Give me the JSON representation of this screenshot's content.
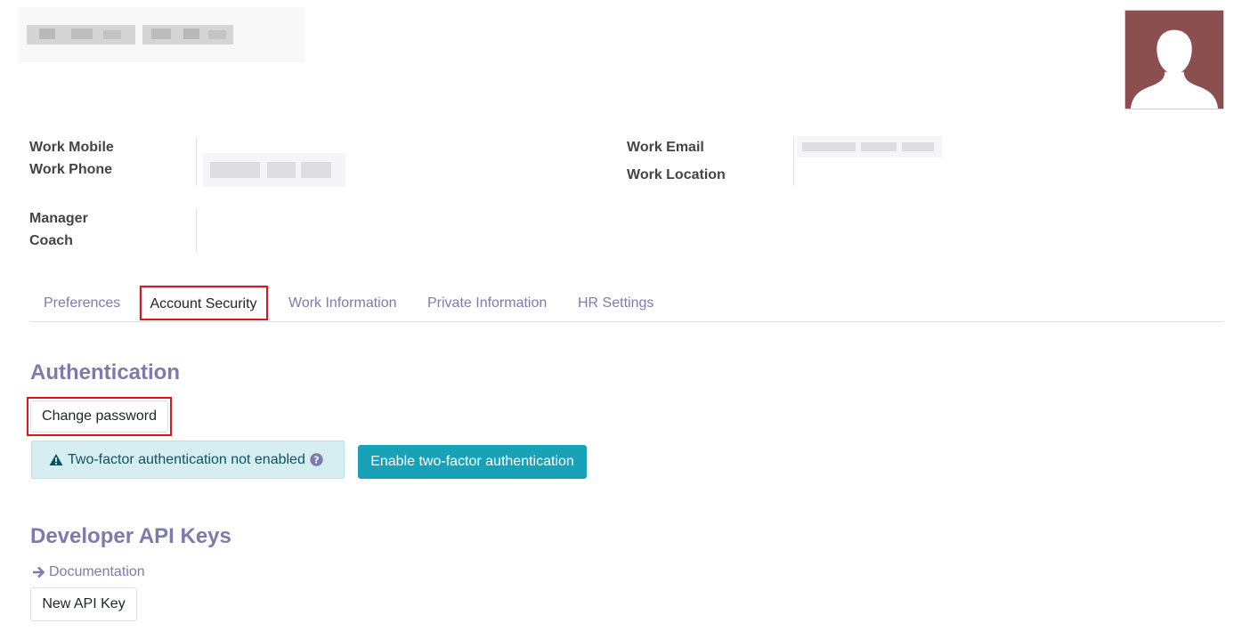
{
  "fields": {
    "work_mobile": "Work Mobile",
    "work_phone": "Work Phone",
    "work_email": "Work Email",
    "work_location": "Work Location",
    "manager": "Manager",
    "coach": "Coach"
  },
  "tabs": [
    {
      "label": "Preferences",
      "active": false
    },
    {
      "label": "Account Security",
      "active": true
    },
    {
      "label": "Work Information",
      "active": false
    },
    {
      "label": "Private Information",
      "active": false
    },
    {
      "label": "HR Settings",
      "active": false
    }
  ],
  "authentication": {
    "title": "Authentication",
    "change_password": "Change password",
    "twofa_status": "Two-factor authentication not enabled",
    "enable_twofa": "Enable two-factor authentication"
  },
  "api_keys": {
    "title": "Developer API Keys",
    "documentation": "Documentation",
    "new_key": "New API Key"
  },
  "colors": {
    "accent": "#7c7bad",
    "primary": "#17a2b8",
    "avatar_bg": "#8b4f4f",
    "highlight": "#e0141c"
  }
}
